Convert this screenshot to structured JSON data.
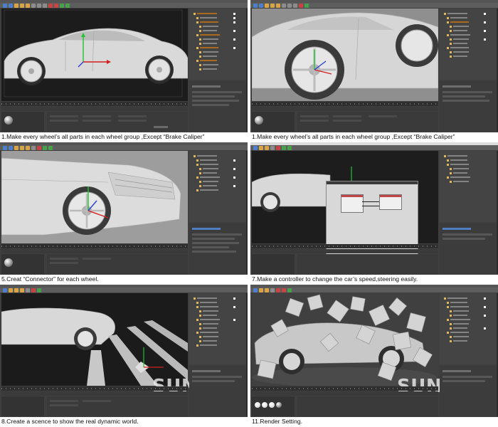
{
  "panels": [
    {
      "caption": "1.Make every wheel’s all parts in  each wheel group ,Except “Brake Caliper”",
      "scene": "car-side"
    },
    {
      "caption": "1.Make every wheel’s all parts in  each wheel group ,Except “Brake Caliper”",
      "scene": "car-wheel-closeup"
    },
    {
      "caption": "5.Creat “Connector” for each wheel.",
      "scene": "car-front-wheel"
    },
    {
      "caption": "7.Make a controller to change the car’s speed,steering easily.",
      "scene": "xpresso-controller"
    },
    {
      "caption": "8.Create a scence to show the real dynamic world.",
      "scene": "car-ramps"
    },
    {
      "caption": "11.Render Setting.",
      "scene": "car-cubes-render"
    }
  ],
  "watermark": "SUNRCB",
  "colors": {
    "ui_dark": "#3f3f3f",
    "viewport_gray": "#9a9a9a",
    "axis_x": "#d21f1f",
    "axis_y": "#22c233",
    "axis_z": "#2a3fd6",
    "object_icon": "#e0b85a",
    "selected_text": "#ff8a00"
  }
}
